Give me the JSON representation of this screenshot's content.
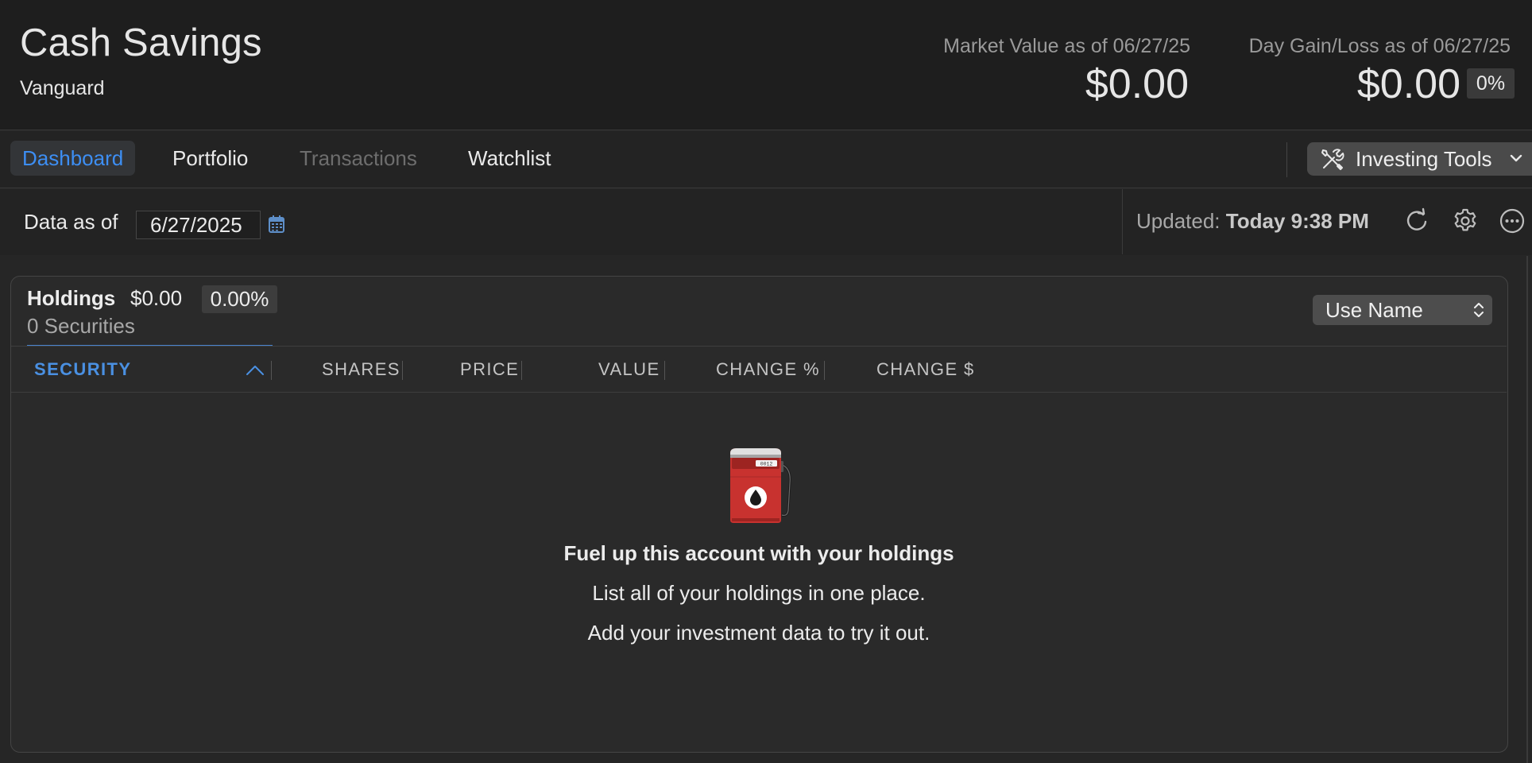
{
  "account": {
    "title": "Cash Savings",
    "institution": "Vanguard",
    "market_value_label": "Market Value as of 06/27/25",
    "market_value": "$0.00",
    "day_gain_label": "Day Gain/Loss as of 06/27/25",
    "day_gain_value": "$0.00",
    "day_gain_pct": "0%"
  },
  "tabs": [
    {
      "label": "Dashboard",
      "state": "active"
    },
    {
      "label": "Portfolio",
      "state": "normal"
    },
    {
      "label": "Transactions",
      "state": "disabled"
    },
    {
      "label": "Watchlist",
      "state": "normal"
    }
  ],
  "tools": {
    "label": "Investing Tools",
    "icon": "tools-icon"
  },
  "databar": {
    "label": "Data as of",
    "date": "6/27/2025",
    "updated_label": "Updated:",
    "updated_value": "Today 9:38 PM"
  },
  "holdings": {
    "title": "Holdings",
    "value": "$0.00",
    "pct": "0.00%",
    "count": "0 Securities",
    "name_mode": "Use Name",
    "columns": [
      "SECURITY",
      "SHARES",
      "PRICE",
      "VALUE",
      "CHANGE %",
      "CHANGE $"
    ],
    "sorted_column": "SECURITY"
  },
  "empty_state": {
    "icon": "fuel-pump-icon",
    "title": "Fuel up this account with your holdings",
    "line1": "List all of your holdings in one place.",
    "line2": "Add your investment data to try it out."
  },
  "colors": {
    "accent": "#3d8ef3",
    "background": "#262626",
    "header_bg": "#1e1e1e",
    "pump_red": "#c8322f"
  }
}
